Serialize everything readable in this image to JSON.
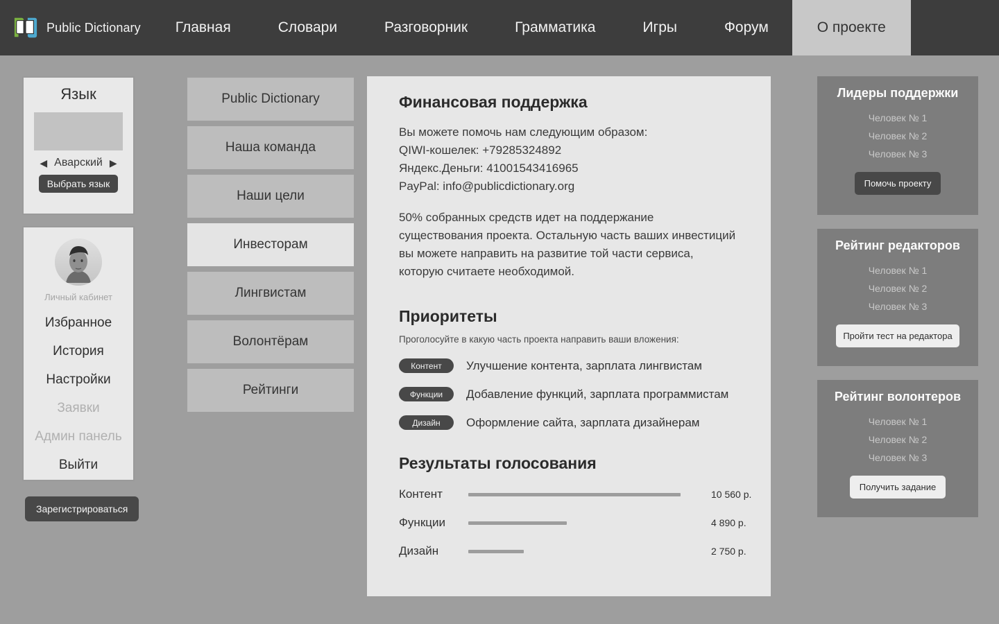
{
  "header": {
    "logo_icon": "pd-book-logo-icon",
    "brand": "Public Dictionary",
    "nav": [
      {
        "label": "Главная",
        "active": false
      },
      {
        "label": "Словари",
        "active": false
      },
      {
        "label": "Разговорник",
        "active": false
      },
      {
        "label": "Грамматика",
        "active": false
      },
      {
        "label": "Игры",
        "active": false
      },
      {
        "label": "Форум",
        "active": false
      },
      {
        "label": "О проекте",
        "active": true
      }
    ]
  },
  "language_card": {
    "title": "Язык",
    "flag_placeholder": "flag-placeholder",
    "prev_icon": "◀",
    "next_icon": "▶",
    "current": "Аварский",
    "button": "Выбрать язык"
  },
  "user_card": {
    "avatar_icon": "user-avatar-photo",
    "cabinet_label": "Личный кабинет",
    "menu": [
      {
        "label": "Избранное",
        "disabled": false
      },
      {
        "label": "История",
        "disabled": false
      },
      {
        "label": "Настройки",
        "disabled": false
      },
      {
        "label": "Заявки",
        "disabled": true
      },
      {
        "label": "Админ панель",
        "disabled": true
      },
      {
        "label": "Выйти",
        "disabled": false
      }
    ]
  },
  "register_button": "Зарегистрироваться",
  "section_nav": [
    {
      "label": "Public Dictionary",
      "active": false
    },
    {
      "label": "Наша команда",
      "active": false
    },
    {
      "label": "Наши цели",
      "active": false
    },
    {
      "label": "Инвесторам",
      "active": true
    },
    {
      "label": "Лингвистам",
      "active": false
    },
    {
      "label": "Волонтёрам",
      "active": false
    },
    {
      "label": "Рейтинги",
      "active": false
    }
  ],
  "main": {
    "title": "Финансовая поддержка",
    "intro_lines": [
      "Вы можете помочь нам следующим образом:",
      "QIWI-кошелек: +79285324892",
      "Яндекс.Деньги: 41001543416965",
      "PayPal: info@publicdictionary.org"
    ],
    "note": "50% собранных средств идет на поддержание существования проекта. Остальную часть ваших инвестиций вы можете направить на развитие той части сервиса, которую считаете необходимой.",
    "priorities_title": "Приоритеты",
    "priorities_hint": "Проголосуйте в какую часть проекта направить ваши вложения:",
    "priorities": [
      {
        "tag": "Контент",
        "description": "Улучшение контента, зарплата лингвистам"
      },
      {
        "tag": "Функции",
        "description": "Добавление функций, зарплата программистам"
      },
      {
        "tag": "Дизайн",
        "description": "Оформление сайта, зарплата дизайнерам"
      }
    ],
    "results_title": "Результаты голосования"
  },
  "chart_data": {
    "type": "bar",
    "title": "Результаты голосования",
    "orientation": "horizontal",
    "categories": [
      "Контент",
      "Функции",
      "Дизайн"
    ],
    "values": [
      10560,
      4890,
      2750
    ],
    "value_labels": [
      "10 560 р.",
      "4 890 р.",
      "2 750 р."
    ],
    "unit": "р.",
    "xlabel": "",
    "ylabel": "",
    "xlim": [
      0,
      11400
    ],
    "grid": false,
    "legend": "none",
    "bar_color": "#9d9d9d"
  },
  "right_panels": [
    {
      "title": "Лидеры поддержки",
      "items": [
        "Человек № 1",
        "Человек № 2",
        "Человек № 3"
      ],
      "button": "Помочь проекту",
      "button_style": "dark"
    },
    {
      "title": "Рейтинг редакторов",
      "items": [
        "Человек № 1",
        "Человек № 2",
        "Человек № 3"
      ],
      "button": "Пройти тест на редактора",
      "button_style": "light"
    },
    {
      "title": "Рейтинг волонтеров",
      "items": [
        "Человек № 1",
        "Человек № 2",
        "Человек № 3"
      ],
      "button": "Получить задание",
      "button_style": "light"
    }
  ],
  "colors": {
    "header_bg": "#3d3d3d",
    "page_bg": "#9e9e9e",
    "panel_bg": "#7d7d7d",
    "card_bg": "#e9e9e9",
    "main_bg": "#e7e7e7",
    "active_tab_bg": "#c8c8c8",
    "logo_green": "#7bb141",
    "logo_blue": "#4ea9cf"
  }
}
